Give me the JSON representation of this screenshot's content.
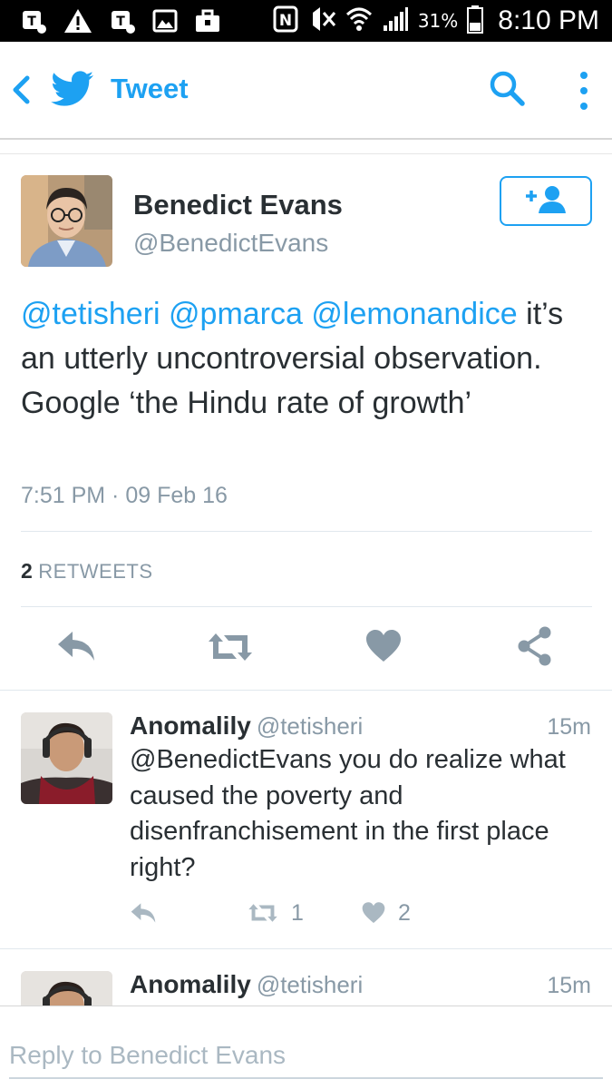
{
  "status_bar": {
    "battery_percent": "31%",
    "time": "8:10 PM"
  },
  "app_bar": {
    "title": "Tweet",
    "back_icon": "chevron-left-icon",
    "logo_icon": "twitter-bird-icon",
    "search_icon": "search-icon",
    "more_icon": "more-vertical-icon",
    "accent": "#1da1f2"
  },
  "main_tweet": {
    "name": "Benedict Evans",
    "handle": "@BenedictEvans",
    "mentions": [
      "@tetisheri",
      "@pmarca",
      "@lemonandice"
    ],
    "text": "it’s an utterly uncontroversial observation. Google ‘the Hindu rate of growth’",
    "timestamp": "7:51 PM · 09 Feb 16",
    "retweet_count": "2",
    "retweet_label": "RETWEETS",
    "follow_icon": "follow-user-icon"
  },
  "replies": [
    {
      "name": "Anomalily",
      "handle": "@tetisheri",
      "time": "15m",
      "text_lines": [
        "@BenedictEvans you do realize what",
        "caused the poverty and",
        "disenfranchisement in the first place",
        "right?"
      ],
      "retweets": "1",
      "likes": "2"
    },
    {
      "name": "Anomalily",
      "handle": "@tetisheri",
      "time": "15m"
    }
  ],
  "reply_bar": {
    "placeholder": "Reply to Benedict Evans"
  }
}
